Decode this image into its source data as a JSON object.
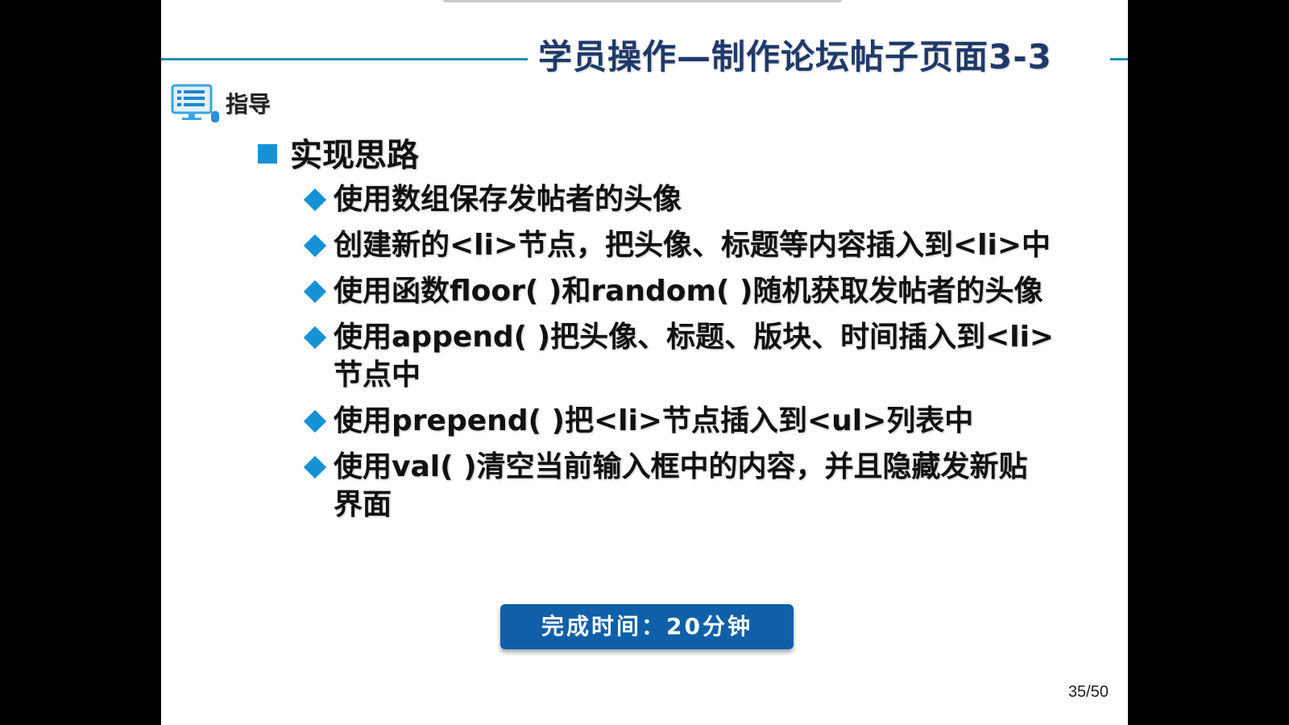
{
  "slide": {
    "title": "学员操作—制作论坛帖子页面3-3",
    "guide_label": "指导",
    "guide_icon": "list-monitor-icon",
    "heading": "实现思路",
    "bullets": [
      {
        "line1": "使用数组保存发帖者的头像",
        "line2": ""
      },
      {
        "line1": "创建新的<li>节点，把头像、标题等内容插入到<li>中",
        "line2": ""
      },
      {
        "line1": "使用函数floor( )和random( )随机获取发帖者的头像",
        "line2": ""
      },
      {
        "line1": "使用append( )把头像、标题、版块、时间插入到<li>",
        "line2": "节点中"
      },
      {
        "line1": "使用prepend( )把<li>节点插入到<ul>列表中",
        "line2": ""
      },
      {
        "line1": "使用val( )清空当前输入框中的内容，并且隐藏发新贴",
        "line2": "界面"
      }
    ],
    "time_box": "完成时间：20分钟",
    "page_number": "35/50"
  },
  "colors": {
    "background": "#000000",
    "slide": "#ffffff",
    "accent": "#1791d6",
    "title": "#1f3a6a",
    "button": "#0f60a8"
  }
}
